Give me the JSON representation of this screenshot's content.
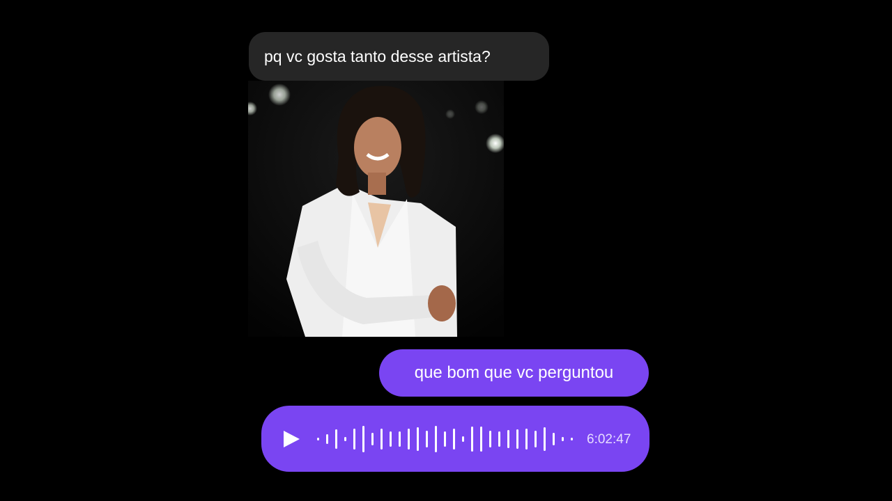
{
  "incoming_message": {
    "text": "pq vc gosta tanto desse artista?"
  },
  "outgoing_message": {
    "text": "que bom que vc perguntou"
  },
  "voice_message": {
    "duration": "6:02:47",
    "play_icon": "play-icon"
  },
  "colors": {
    "background": "#000000",
    "incoming_bubble": "#262626",
    "outgoing_bubble": "#7a45f2",
    "text": "#ffffff"
  }
}
